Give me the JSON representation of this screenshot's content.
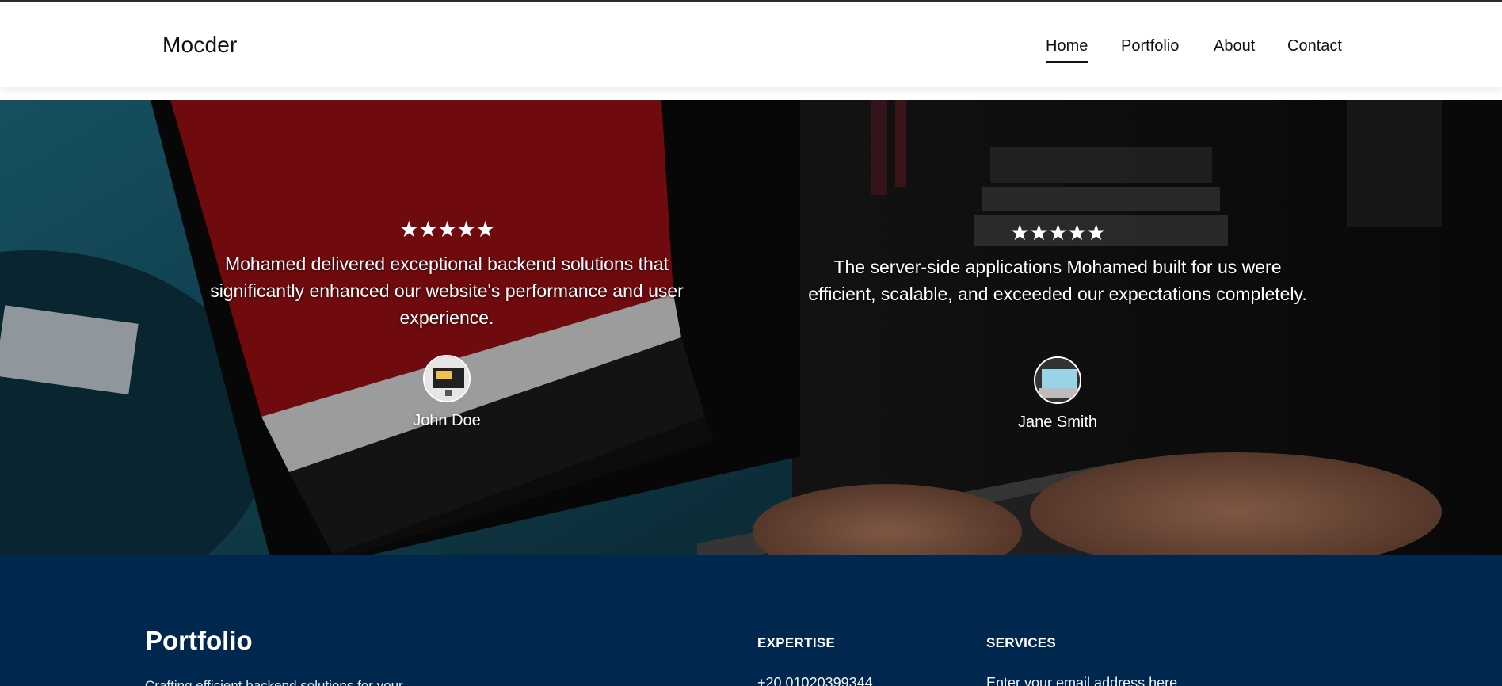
{
  "navbar": {
    "logo": "Mocder",
    "links": [
      "Home",
      "Portfolio",
      "About",
      "Contact"
    ],
    "active": "Home"
  },
  "testimonials": [
    {
      "stars": "★★★★★",
      "rating": 5,
      "quote": "Mohamed delivered exceptional backend solutions that significantly enhanced our website's performance and user experience.",
      "author": "John Doe"
    },
    {
      "stars": "★★★★★",
      "rating": 5,
      "quote": "The server-side applications Mohamed built for us were efficient, scalable, and exceeded our expectations completely.",
      "author": "Jane Smith"
    }
  ],
  "footer": {
    "title": "Portfolio",
    "tagline": "Crafting efficient backend solutions for your",
    "expertise_heading": "EXPERTISE",
    "phone": "+20 01020399344",
    "services_heading": "SERVICES",
    "email_placeholder": "Enter your email address here"
  },
  "colors": {
    "footer_bg": "#00284e",
    "nav_bg": "#ffffff",
    "text_dark": "#111111"
  }
}
